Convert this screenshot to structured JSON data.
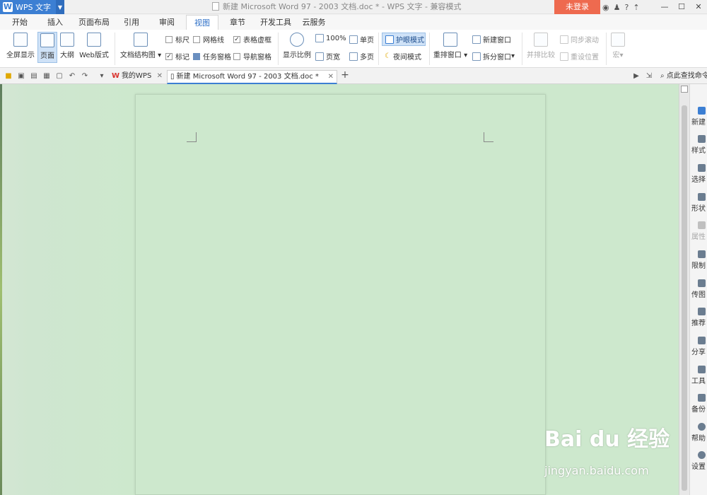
{
  "titlebar": {
    "app_name": "WPS 文字",
    "app_logo": "W",
    "document_title": "新建 Microsoft Word 97 - 2003 文档.doc * - WPS 文字 - 兼容模式",
    "login_label": "未登录",
    "help_label": "?"
  },
  "menu_tabs": [
    "开始",
    "插入",
    "页面布局",
    "引用",
    "审阅",
    "视图",
    "章节",
    "开发工具",
    "云服务"
  ],
  "active_menu_tab": "视图",
  "ribbon": {
    "fullscreen": "全屏显示",
    "page": "页面",
    "outline": "大纲",
    "web": "Web版式",
    "doc_structure": "文档结构图",
    "ruler": "标尺",
    "gridlines": "网格线",
    "table_gridlines": "表格虚框",
    "markup": "标记",
    "task_pane": "任务窗格",
    "nav_pane": "导航窗格",
    "zoom": "显示比例",
    "zoom_100": "100%",
    "page_width": "页宽",
    "single_page": "单页",
    "multi_page": "多页",
    "eye_mode": "护眼模式",
    "night_mode": "夜间模式",
    "arrange": "重排窗口",
    "new_window": "新建窗口",
    "split_window": "拆分窗口",
    "side_by_side": "并排比较",
    "sync_scroll": "同步滚动",
    "reset_position": "重设位置",
    "macro": "宏"
  },
  "doc_tabs": [
    {
      "label": "我的WPS",
      "active": false
    },
    {
      "label": "新建 Microsoft Word 97 - 2003 文档.doc *",
      "active": true
    }
  ],
  "search_tip": "点此查找命令",
  "side_panel": [
    {
      "label": "新建",
      "disabled": false
    },
    {
      "label": "样式",
      "disabled": false
    },
    {
      "label": "选择",
      "disabled": false
    },
    {
      "label": "形状",
      "disabled": false
    },
    {
      "label": "属性",
      "disabled": true
    },
    {
      "label": "限制",
      "disabled": false
    },
    {
      "label": "传图",
      "disabled": false
    },
    {
      "label": "推荐",
      "disabled": false
    },
    {
      "label": "分享",
      "disabled": false
    },
    {
      "label": "工具",
      "disabled": false
    },
    {
      "label": "备份",
      "disabled": false
    },
    {
      "label": "帮助",
      "disabled": false
    },
    {
      "label": "设置",
      "disabled": false
    }
  ],
  "watermark": {
    "main": "Bai du 经验",
    "sub": "jingyan.baidu.com"
  },
  "colors": {
    "accent": "#3c7fd3",
    "login": "#ee6a4f",
    "page_bg": "#cde8cd"
  }
}
